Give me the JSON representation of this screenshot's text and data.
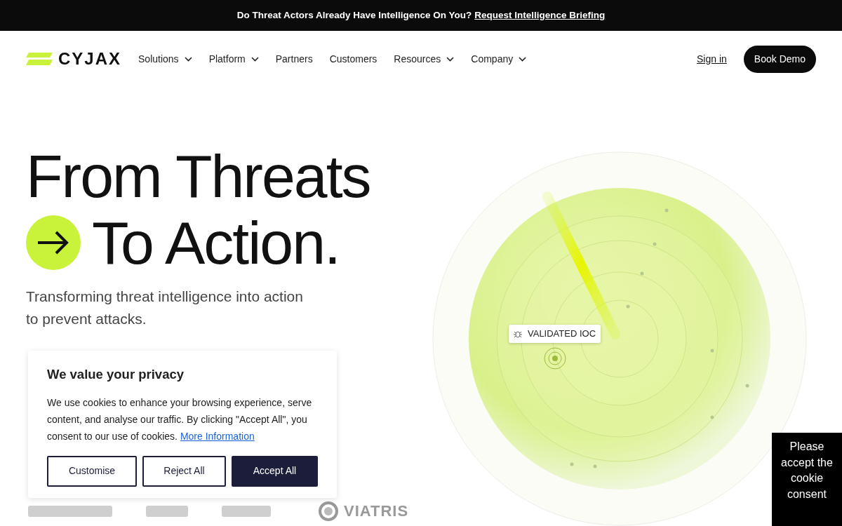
{
  "announcement": {
    "text": "Do Threat Actors Already Have Intelligence On You?",
    "link": "Request Intelligence Briefing"
  },
  "nav": {
    "logo": "CYJAX",
    "items": [
      {
        "label": "Solutions",
        "dropdown": true
      },
      {
        "label": "Platform",
        "dropdown": true
      },
      {
        "label": "Partners",
        "dropdown": false
      },
      {
        "label": "Customers",
        "dropdown": false
      },
      {
        "label": "Resources",
        "dropdown": true
      },
      {
        "label": "Company",
        "dropdown": true
      }
    ],
    "sign_in": "Sign in",
    "cta": "Book Demo"
  },
  "hero": {
    "title_line1": "From Threats",
    "title_line2": "To Action.",
    "subtitle": "Transforming threat intelligence into action to prevent attacks.",
    "radar_label": "VALIDATED IOC",
    "logos": [
      "VIATRIS"
    ]
  },
  "cookie_banner": {
    "title": "We value your privacy",
    "text": "We use cookies to enhance your browsing experience, serve content, and analyse our traffic. By clicking \"Accept All\", you consent to our use of cookies.",
    "link": "More Information",
    "buttons": [
      {
        "label": "Customise",
        "kind": "outline"
      },
      {
        "label": "Reject All",
        "kind": "outline"
      },
      {
        "label": "Accept All",
        "kind": "solid"
      }
    ]
  },
  "cookie_notice": "Please accept the cookie consent"
}
